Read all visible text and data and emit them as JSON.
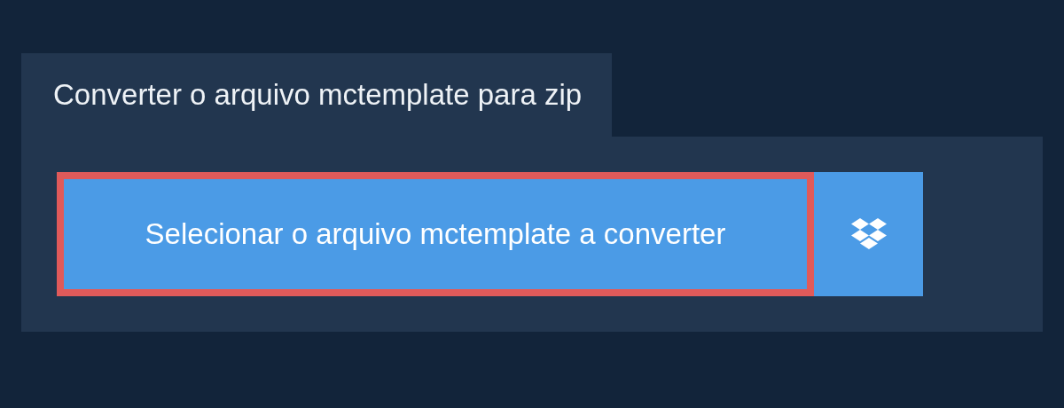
{
  "tab": {
    "title": "Converter o arquivo mctemplate para zip"
  },
  "select_button": {
    "label": "Selecionar o arquivo mctemplate a converter",
    "focused": true
  }
}
